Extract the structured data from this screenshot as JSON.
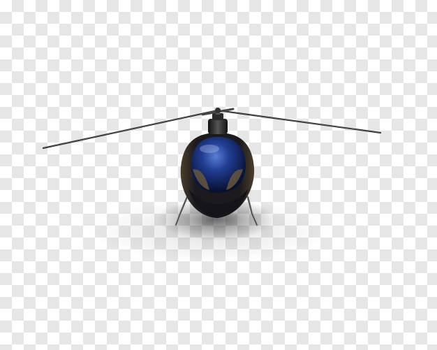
{
  "image": {
    "background": "transparency-checkerboard",
    "subject": "helicopter-front-view",
    "colors": {
      "checker_light": "#ffffff",
      "checker_dark": "#e6e6e6",
      "body_dark": "#1b1a22",
      "canopy_blue": "#1c3a8a",
      "rotor": "#2a2a2a",
      "skid_metal": "#8a8a8a"
    }
  }
}
